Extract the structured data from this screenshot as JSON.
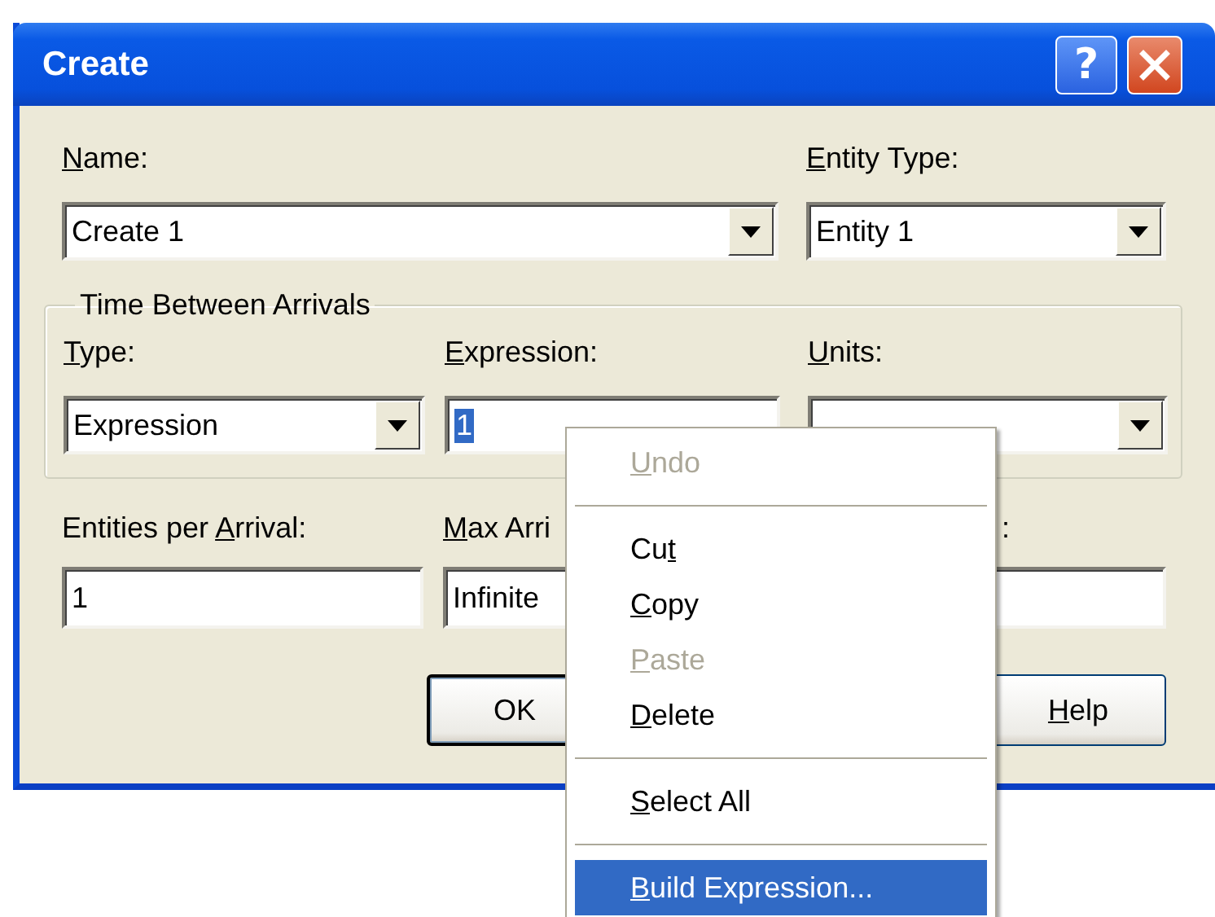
{
  "window": {
    "title": "Create",
    "help_button": "?"
  },
  "name": {
    "label": {
      "key": "N",
      "after": "ame:"
    },
    "value": "Create 1"
  },
  "entity_type": {
    "label": {
      "key": "E",
      "after": "ntity Type:"
    },
    "value": "Entity 1"
  },
  "time_between_arrivals": {
    "title": "Time Between Arrivals",
    "type": {
      "label": {
        "key": "T",
        "after": "ype:"
      },
      "value": "Expression"
    },
    "expression": {
      "label": {
        "key": "E",
        "after": "xpression:"
      },
      "value": "1",
      "text_selected": true
    },
    "units": {
      "label": {
        "key": "U",
        "after": "nits:"
      }
    }
  },
  "entities_per_arrival": {
    "label": {
      "before": "Entities per ",
      "key": "A",
      "after": "rrival:"
    },
    "value": "1"
  },
  "max_arrivals": {
    "label": {
      "key": "M",
      "after": "ax Arri"
    },
    "value": "Infinite"
  },
  "field_3": {
    "label": {
      "after": ":"
    }
  },
  "buttons": [
    {
      "label": {
        "after": "OK"
      },
      "default": true
    },
    {
      "label": {
        "key": "H",
        "after": "elp"
      },
      "default": false
    }
  ],
  "menu": {
    "items": [
      {
        "kind": "item",
        "label": {
          "key": "U",
          "after": "ndo"
        },
        "disabled": true,
        "selected": false
      },
      {
        "kind": "separator"
      },
      {
        "kind": "item",
        "label": {
          "before": "Cu",
          "key": "t"
        },
        "disabled": false,
        "selected": false
      },
      {
        "kind": "item",
        "label": {
          "key": "C",
          "after": "opy"
        },
        "disabled": false,
        "selected": false
      },
      {
        "kind": "item",
        "label": {
          "key": "P",
          "after": "aste"
        },
        "disabled": true,
        "selected": false
      },
      {
        "kind": "item",
        "label": {
          "key": "D",
          "after": "elete"
        },
        "disabled": false,
        "selected": false
      },
      {
        "kind": "separator"
      },
      {
        "kind": "item",
        "label": {
          "key": "S",
          "after": "elect All"
        },
        "disabled": false,
        "selected": false
      },
      {
        "kind": "separator"
      },
      {
        "kind": "item",
        "label": {
          "key": "B",
          "after": "uild Expression..."
        },
        "disabled": false,
        "selected": true
      }
    ]
  }
}
